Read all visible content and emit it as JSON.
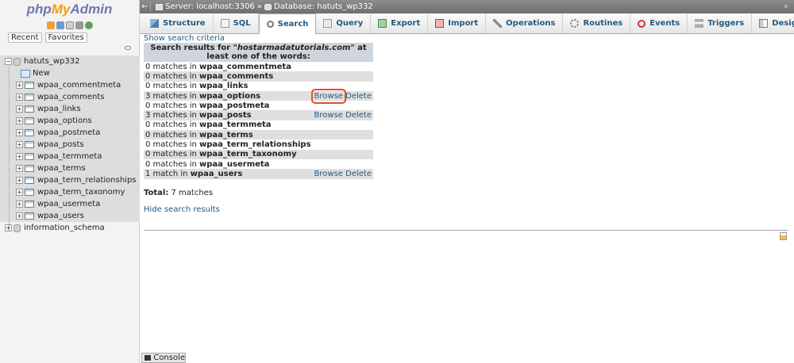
{
  "logo": {
    "php": "php",
    "my": "My",
    "admin": "Admin"
  },
  "nav": {
    "tabs": [
      "Recent",
      "Favorites"
    ],
    "tree": [
      {
        "label": "hatuts_wp332",
        "type": "db",
        "expanded": true
      },
      {
        "label": "New",
        "type": "new"
      },
      {
        "label": "wpaa_commentmeta",
        "type": "table"
      },
      {
        "label": "wpaa_comments",
        "type": "table"
      },
      {
        "label": "wpaa_links",
        "type": "table"
      },
      {
        "label": "wpaa_options",
        "type": "table"
      },
      {
        "label": "wpaa_postmeta",
        "type": "table"
      },
      {
        "label": "wpaa_posts",
        "type": "table"
      },
      {
        "label": "wpaa_termmeta",
        "type": "table"
      },
      {
        "label": "wpaa_terms",
        "type": "table"
      },
      {
        "label": "wpaa_term_relationships",
        "type": "table"
      },
      {
        "label": "wpaa_term_taxonomy",
        "type": "table"
      },
      {
        "label": "wpaa_usermeta",
        "type": "table"
      },
      {
        "label": "wpaa_users",
        "type": "table"
      },
      {
        "label": "information_schema",
        "type": "db",
        "expanded": false
      }
    ]
  },
  "topbar": {
    "server": "Server: localhost:3306",
    "separator": "»",
    "database": "Database: hatuts_wp332"
  },
  "tabs": [
    {
      "label": "Structure",
      "icon": "structure-icon"
    },
    {
      "label": "SQL",
      "icon": "sql-icon"
    },
    {
      "label": "Search",
      "icon": "search-icon",
      "active": true
    },
    {
      "label": "Query",
      "icon": "query-icon"
    },
    {
      "label": "Export",
      "icon": "export-icon"
    },
    {
      "label": "Import",
      "icon": "import-icon"
    },
    {
      "label": "Operations",
      "icon": "operations-icon"
    },
    {
      "label": "Routines",
      "icon": "routines-icon"
    },
    {
      "label": "Events",
      "icon": "events-icon"
    },
    {
      "label": "Triggers",
      "icon": "triggers-icon"
    },
    {
      "label": "Designer",
      "icon": "designer-icon"
    }
  ],
  "main": {
    "show_criteria": "Show search criteria",
    "results_header": "Search results for \"hostarmadatutorials.com\" at least one of the words:",
    "header_prefix": "Search results for ",
    "header_term": "\"hostarmadatutorials.com\"",
    "header_suffix": " at least one of the words:",
    "rows": [
      {
        "count": "0 matches in",
        "table": "wpaa_commentmeta",
        "actions": false
      },
      {
        "count": "0 matches in",
        "table": "wpaa_comments",
        "actions": false
      },
      {
        "count": "0 matches in",
        "table": "wpaa_links",
        "actions": false
      },
      {
        "count": "3 matches in",
        "table": "wpaa_options",
        "actions": true,
        "highlight": true
      },
      {
        "count": "0 matches in",
        "table": "wpaa_postmeta",
        "actions": false
      },
      {
        "count": "3 matches in",
        "table": "wpaa_posts",
        "actions": true
      },
      {
        "count": "0 matches in",
        "table": "wpaa_termmeta",
        "actions": false
      },
      {
        "count": "0 matches in",
        "table": "wpaa_terms",
        "actions": false
      },
      {
        "count": "0 matches in",
        "table": "wpaa_term_relationships",
        "actions": false
      },
      {
        "count": "0 matches in",
        "table": "wpaa_term_taxonomy",
        "actions": false
      },
      {
        "count": "0 matches in",
        "table": "wpaa_usermeta",
        "actions": false
      },
      {
        "count": "1 match in",
        "table": "wpaa_users",
        "actions": true
      }
    ],
    "browse_label": "Browse",
    "delete_label": "Delete",
    "total_label": "Total:",
    "total_value": "7 matches",
    "hide_results": "Hide search results"
  },
  "console": {
    "label": "Console"
  },
  "colors": {
    "link": "#235a81",
    "highlight": "#e44b32",
    "header_bg": "#cfd5dc"
  }
}
